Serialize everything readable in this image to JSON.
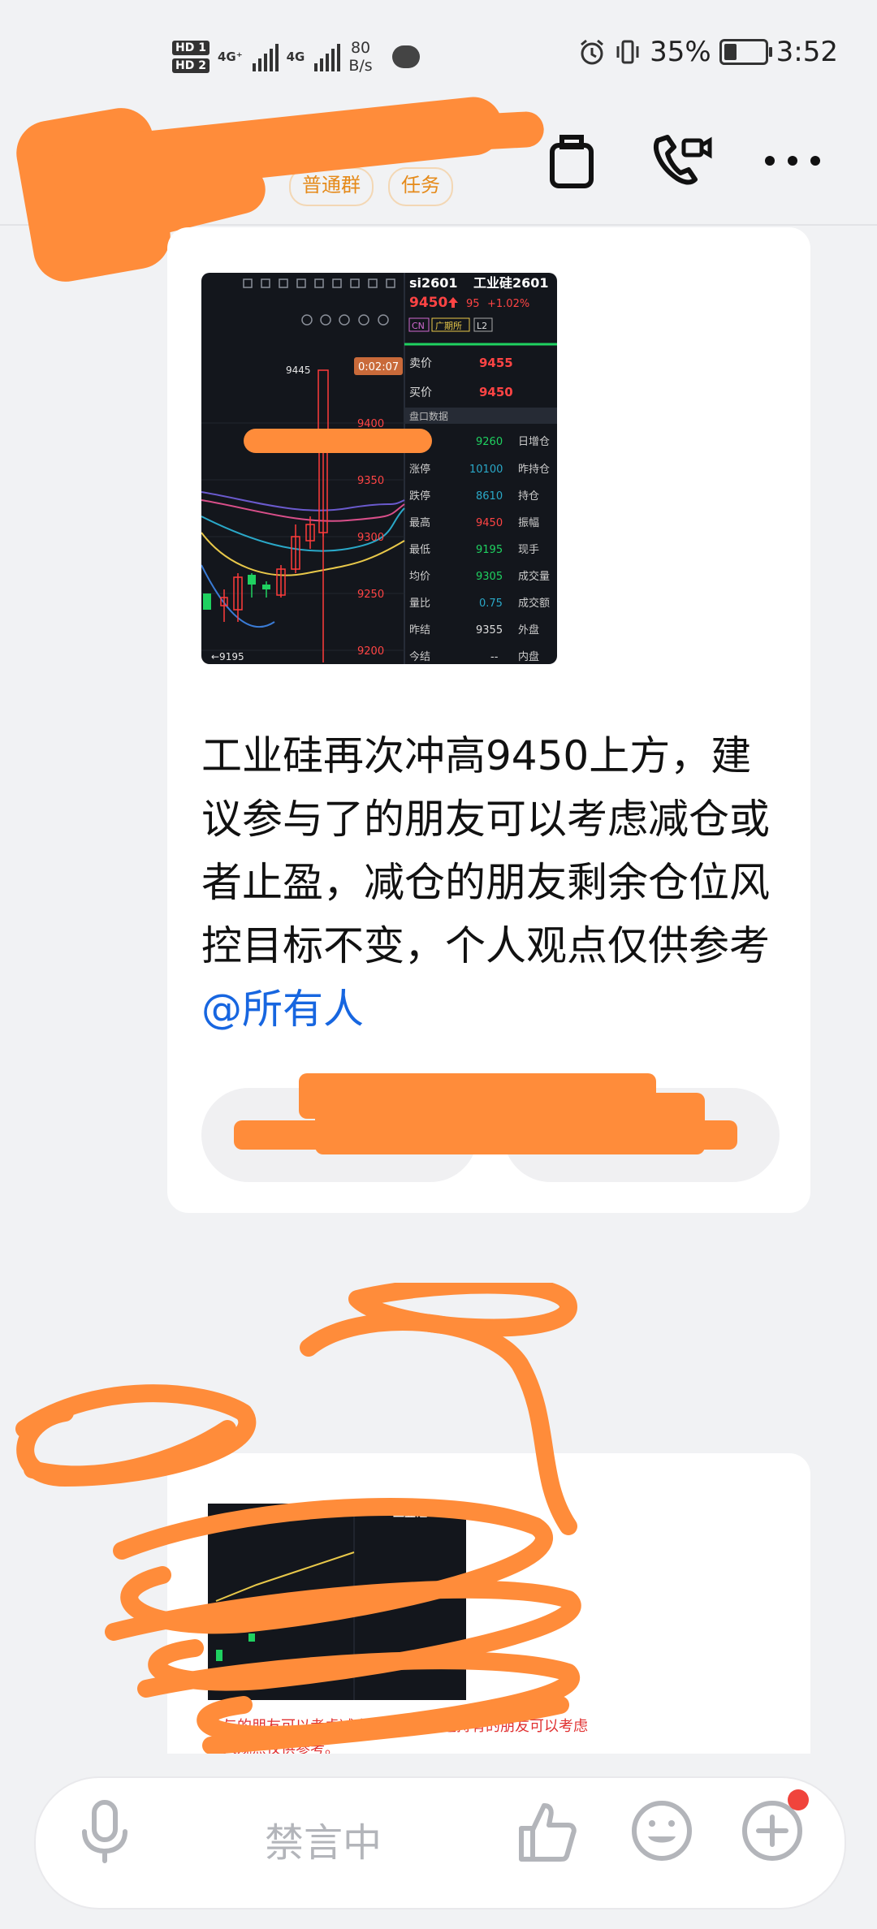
{
  "status_bar": {
    "sim1_label": "HD 1",
    "sim2_label": "HD 2",
    "net1": "4G⁺",
    "net2": "4G",
    "speed_value": "80",
    "speed_unit": "B/s",
    "battery": "35%",
    "battery_level": 0.35,
    "time": "3:52"
  },
  "header": {
    "tag_group": "普通群",
    "tag_task": "任务",
    "icons": [
      "back-icon",
      "clipboard-icon",
      "video-call-icon",
      "more-icon"
    ]
  },
  "chat": {
    "message_text": "工业硅再次冲高9450上方，建议参与了的朋友可以考虑减仓或者止盈，减仓的朋友剩余仓位风控目标不变，个人观点仅供参考 ",
    "mention": "@所有人"
  },
  "quote_panel": {
    "symbol": "si2601",
    "name": "工业硅2601",
    "price": "9450",
    "change": "95",
    "change_pct": "+1.02%",
    "badges": [
      "CN",
      "广期所",
      "L2"
    ],
    "timer": "0:02:07",
    "high_marker": "9445",
    "low_marker": "←9195",
    "ask_label": "卖价",
    "ask_value": "9455",
    "bid_label": "买价",
    "bid_value": "9450",
    "section_label": "盘口数据",
    "rows": [
      {
        "label": "",
        "value": "9260",
        "right": "日增仓"
      },
      {
        "label": "涨停",
        "value": "10100",
        "right": "昨持仓"
      },
      {
        "label": "跌停",
        "value": "8610",
        "right": "持仓"
      },
      {
        "label": "最高",
        "value": "9450",
        "right": "振幅"
      },
      {
        "label": "最低",
        "value": "9195",
        "right": "现手"
      },
      {
        "label": "均价",
        "value": "9305",
        "right": "成交量"
      },
      {
        "label": "量比",
        "value": "0.75",
        "right": "成交额"
      },
      {
        "label": "昨结",
        "value": "9355",
        "right": "外盘"
      },
      {
        "label": "今结",
        "value": "--",
        "right": "内盘"
      }
    ],
    "y_ticks": [
      "9400",
      "9350",
      "9300",
      "9250",
      "9200"
    ]
  },
  "second_message": {
    "panel_name": "工业硅2601",
    "preview_line1": "参与的朋友可以考虑减仓或者止盈，还持有的朋友可以考虑",
    "preview_line2": "个人观点仅供参考。"
  },
  "composer": {
    "muted_label": "禁言中",
    "icons": [
      "mic-icon",
      "like-icon",
      "emoji-icon",
      "plus-icon"
    ],
    "accent_badge_color": "#f0443c"
  },
  "colors": {
    "mention": "#1766e0",
    "tag": "#e58a1a",
    "redaction": "#ff8c3a",
    "up": "#ff3b3b",
    "down": "#1fd160"
  }
}
